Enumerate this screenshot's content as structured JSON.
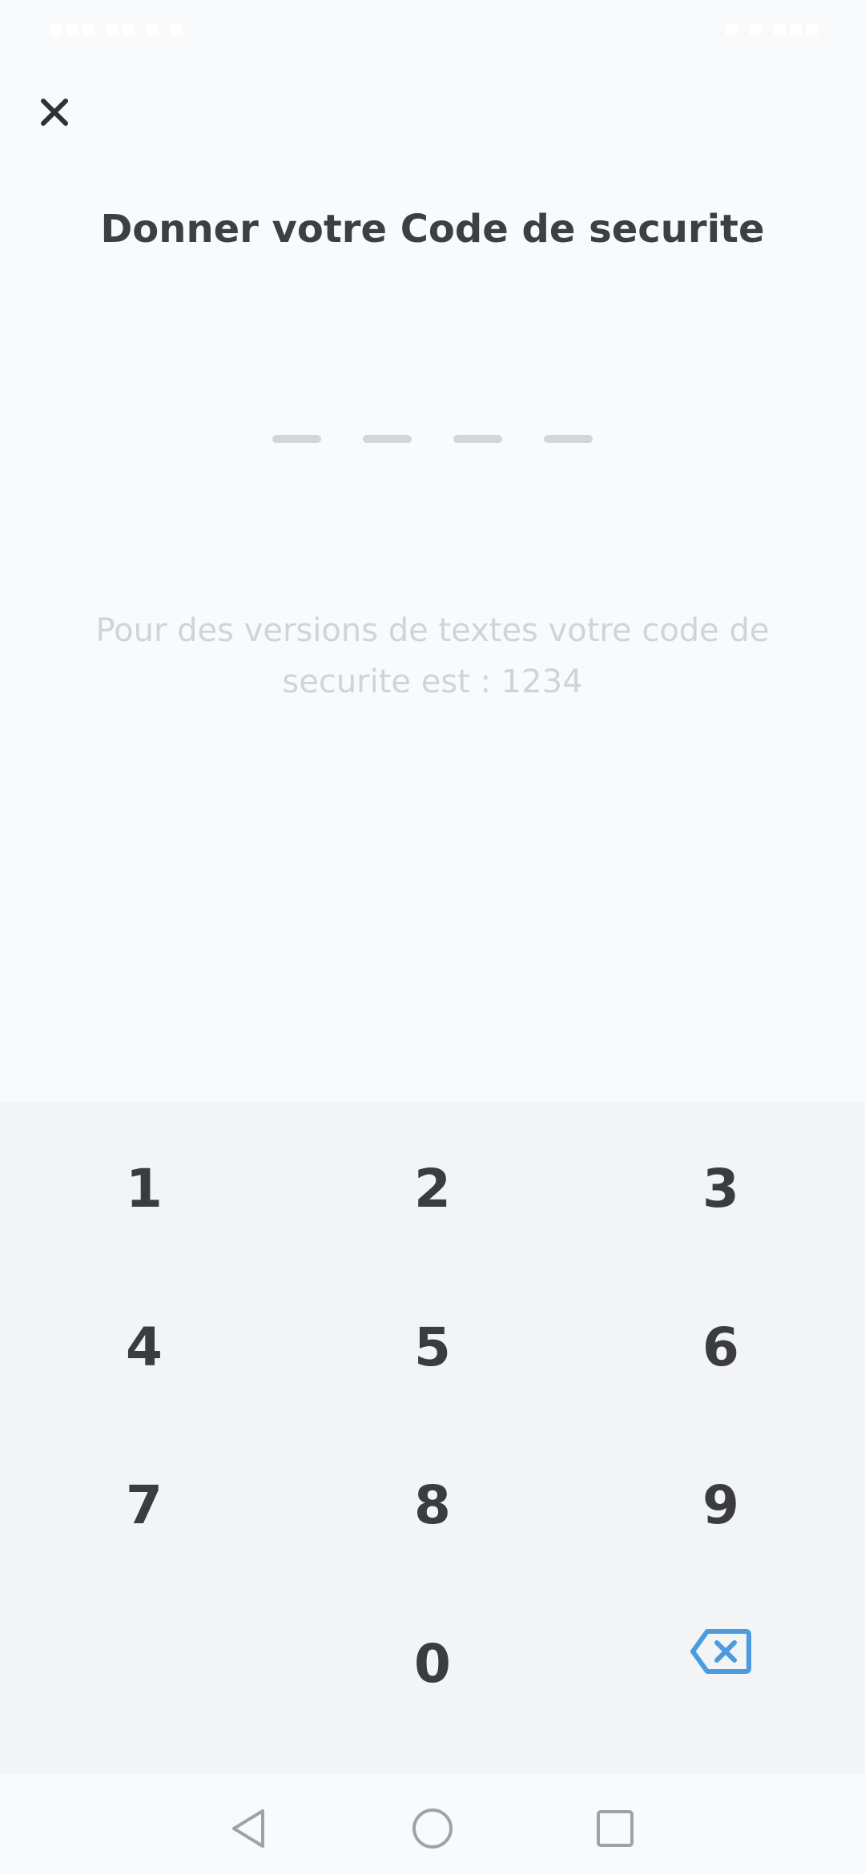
{
  "status_bar": {
    "left_text": "▪▪▪ ▪▪ ▪ ▪",
    "right_text": "▪ ▪ ▪▪▪"
  },
  "header": {
    "close_icon": "close-icon",
    "title": "Donner votre Code de securite"
  },
  "pin": {
    "length": 4,
    "entered": 0
  },
  "hint": {
    "text": "Pour des versions de textes votre code de securite est : 1234"
  },
  "keypad": {
    "keys": [
      "1",
      "2",
      "3",
      "4",
      "5",
      "6",
      "7",
      "8",
      "9",
      "0"
    ],
    "backspace_icon": "backspace-icon",
    "accent": "#4a9be0"
  },
  "nav_bar": {
    "back_icon": "back-triangle-icon",
    "home_icon": "home-circle-icon",
    "recents_icon": "recents-square-icon"
  }
}
